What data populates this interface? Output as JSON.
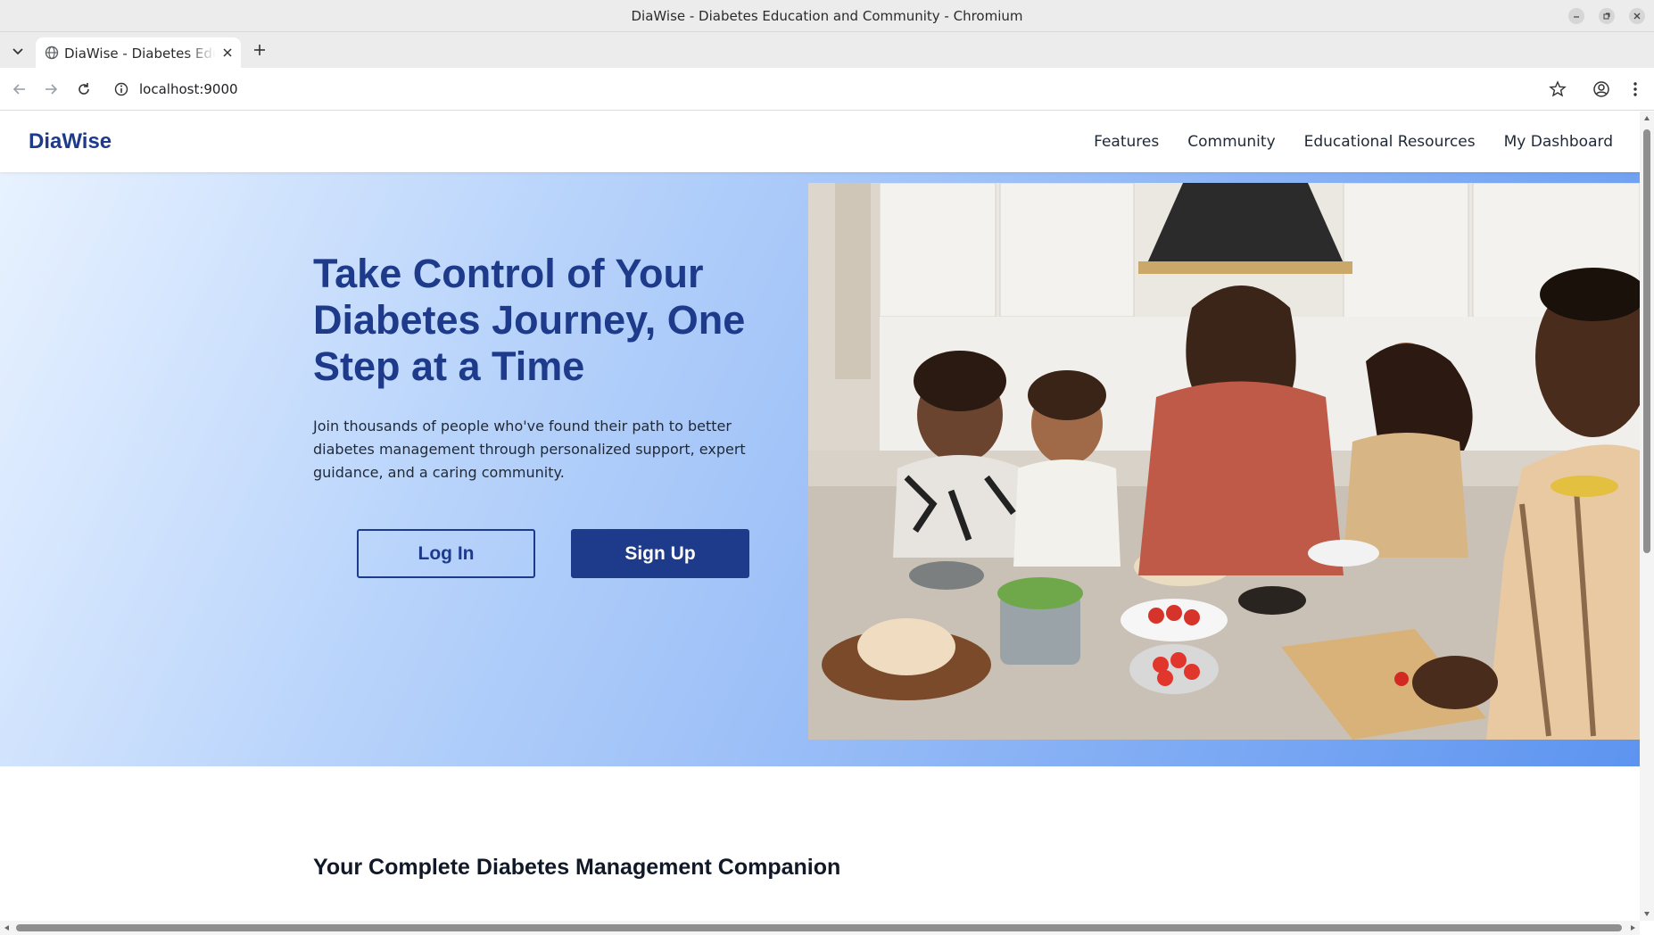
{
  "window": {
    "title": "DiaWise - Diabetes Education and Community - Chromium"
  },
  "tabs": [
    {
      "label": "DiaWise - Diabetes Education and Community",
      "active": true
    }
  ],
  "toolbar": {
    "url": "localhost:9000"
  },
  "site": {
    "logo": "DiaWise",
    "nav": [
      {
        "label": "Features"
      },
      {
        "label": "Community"
      },
      {
        "label": "Educational Resources"
      },
      {
        "label": "My Dashboard"
      }
    ]
  },
  "hero": {
    "title": "Take Control of Your Diabetes Journey, One Step at a Time",
    "description": "Join thousands of people who've found their path to better diabetes management through personalized support, expert guidance, and a caring community.",
    "login_label": "Log In",
    "signup_label": "Sign Up"
  },
  "features": {
    "title": "Your Complete Diabetes Management Companion"
  },
  "colors": {
    "brand": "#1e3a8a",
    "hero_gradient_start": "#e8f2ff",
    "hero_gradient_end": "#5d94f0"
  }
}
